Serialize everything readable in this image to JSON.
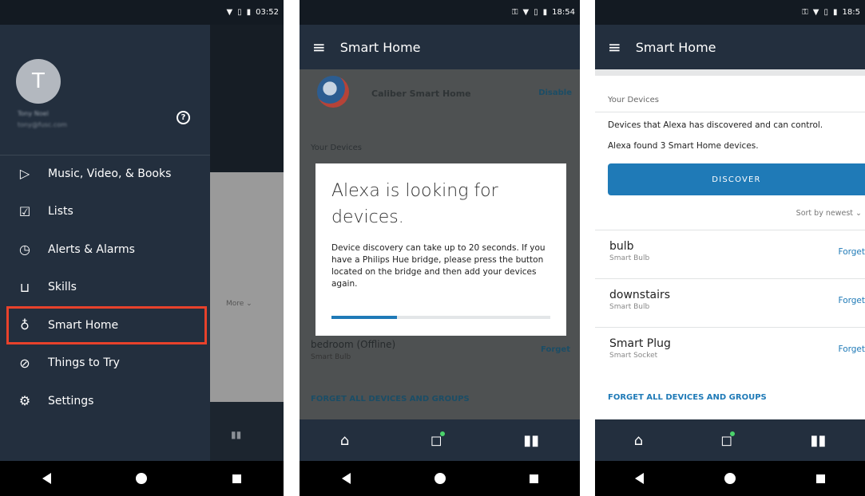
{
  "panel1": {
    "status_time": "03:52",
    "avatar_letter": "T",
    "user_name": "Tony Noel",
    "user_email": "tony@fusc.com",
    "menu": [
      {
        "icon": "play-icon",
        "label": "Music, Video, & Books"
      },
      {
        "icon": "checklist-icon",
        "label": "Lists"
      },
      {
        "icon": "alarm-icon",
        "label": "Alerts & Alarms"
      },
      {
        "icon": "cart-icon",
        "label": "Skills"
      },
      {
        "icon": "lightbulb-icon",
        "label": "Smart Home",
        "selected": true
      },
      {
        "icon": "compass-icon",
        "label": "Things to Try"
      },
      {
        "icon": "gear-icon",
        "label": "Settings"
      }
    ],
    "background_more": "More"
  },
  "panel2": {
    "status_time": "18:54",
    "title": "Smart Home",
    "skill_name": "Caliber Smart Home",
    "skill_action": "Disable",
    "section_label": "Your Devices",
    "device_name": "bedroom (Offline)",
    "device_type": "Smart Bulb",
    "device_action": "Forget",
    "forget_all": "FORGET ALL DEVICES AND GROUPS",
    "dialog": {
      "title": "Alexa is looking for devices.",
      "body": "Device discovery can take up to 20 seconds. If you have a Philips Hue bridge, please press the button located on the bridge and then add your devices again.",
      "progress": 0.3
    }
  },
  "panel3": {
    "status_time": "18:5",
    "title": "Smart Home",
    "section_label": "Your Devices",
    "description": "Devices that Alexa has discovered and can control.",
    "found_text": "Alexa found 3 Smart Home devices.",
    "discover_label": "DISCOVER",
    "sort_label": "Sort by newest",
    "devices": [
      {
        "name": "bulb",
        "type": "Smart Bulb",
        "action": "Forget"
      },
      {
        "name": "downstairs",
        "type": "Smart Bulb",
        "action": "Forget"
      },
      {
        "name": "Smart Plug",
        "type": "Smart Socket",
        "action": "Forget"
      }
    ],
    "forget_all": "FORGET ALL DEVICES AND GROUPS"
  },
  "colors": {
    "app_dark": "#232f3e",
    "accent_blue": "#1f7ab7",
    "selection_red": "#e8422b"
  }
}
